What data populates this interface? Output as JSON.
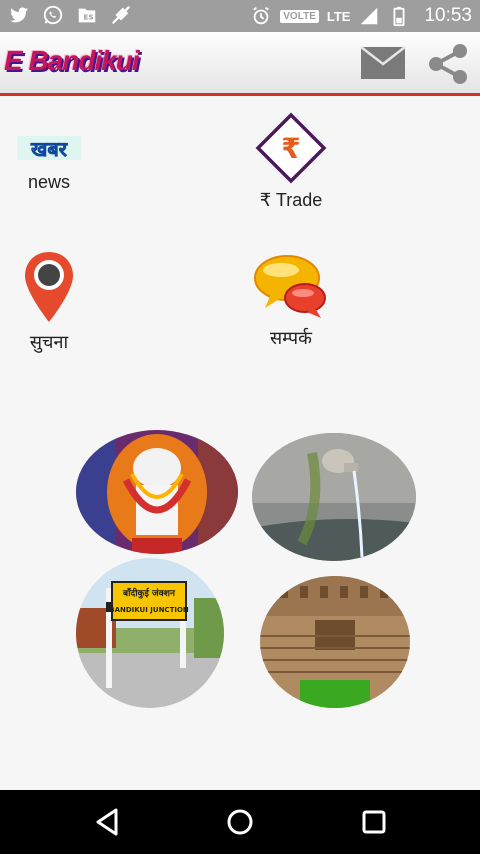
{
  "status_bar": {
    "time": "10:53",
    "volte": "VOLTE",
    "network": "LTE",
    "icons": [
      "twitter-icon",
      "whatsapp-icon",
      "es-file-icon",
      "mute-icon",
      "alarm-icon",
      "signal-icon",
      "battery-icon"
    ]
  },
  "app_bar": {
    "title": "E Bandikui",
    "actions": [
      "mail-icon",
      "share-icon"
    ],
    "accent_color": "#d32f2f"
  },
  "grid": {
    "items": [
      {
        "label": "news",
        "icon": "khabar-icon",
        "icon_text": "खबर"
      },
      {
        "label": "₹ Trade",
        "icon": "rupee-diamond-icon",
        "icon_text": "₹"
      },
      {
        "label": "सुचना",
        "icon": "location-pin-icon"
      },
      {
        "label": "सम्पर्क",
        "icon": "chat-bubbles-icon"
      }
    ]
  },
  "photos": [
    {
      "name": "temple-deity-photo"
    },
    {
      "name": "water-spout-photo"
    },
    {
      "name": "bandikui-junction-photo",
      "sign_text": "बाँदीकुई जंक्शन",
      "sign_text_en": "BANDIKUI JUNCTION"
    },
    {
      "name": "stepwell-photo"
    }
  ],
  "nav_bar": {
    "buttons": [
      "back-icon",
      "home-icon",
      "recent-apps-icon"
    ]
  }
}
